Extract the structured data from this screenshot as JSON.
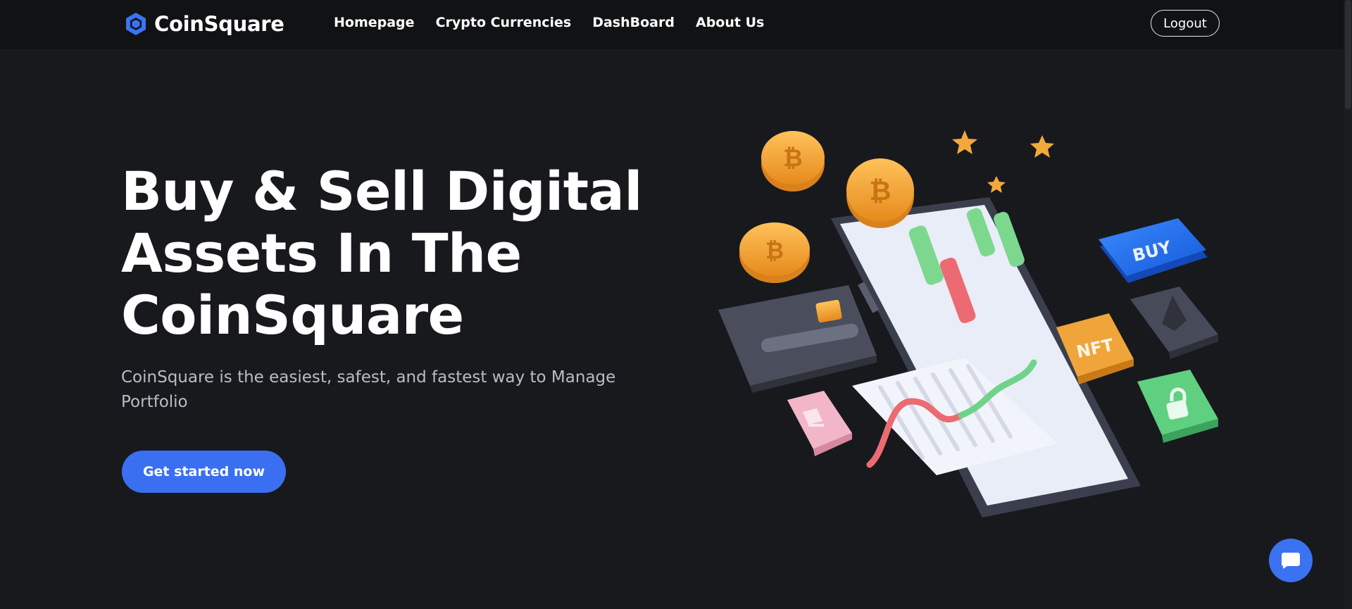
{
  "navbar": {
    "brand": "CoinSquare",
    "links": [
      "Homepage",
      "Crypto Currencies",
      "DashBoard",
      "About Us"
    ],
    "logout_label": "Logout"
  },
  "hero": {
    "title_lines": [
      "Buy & Sell Digital",
      "Assets In The",
      "CoinSquare"
    ],
    "subtitle": "CoinSquare is the easiest, safest, and fastest way to Manage Portfolio",
    "cta_label": "Get started now"
  },
  "illustration": {
    "buy_label": "BUY",
    "nft_label": "NFT",
    "coin_symbol": "₿"
  },
  "colors": {
    "background": "#18191d",
    "navbar": "#111214",
    "accent": "#3a6ff2",
    "subtitle_text": "#b9bcc6"
  },
  "icons": {
    "brand_logo": "cube-icon",
    "chat": "chat-bubble-icon"
  }
}
